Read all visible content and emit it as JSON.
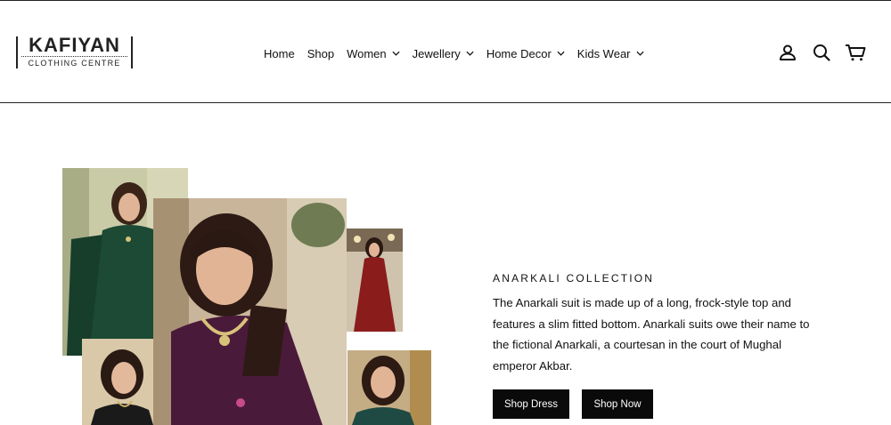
{
  "header": {
    "logo": {
      "name": "KAFIYAN",
      "tagline": "CLOTHING CENTRE"
    },
    "nav": [
      {
        "label": "Home",
        "dropdown": false
      },
      {
        "label": "Shop",
        "dropdown": false
      },
      {
        "label": "Women",
        "dropdown": true
      },
      {
        "label": "Jewellery",
        "dropdown": true
      },
      {
        "label": "Home Decor",
        "dropdown": true
      },
      {
        "label": "Kids Wear",
        "dropdown": true
      }
    ],
    "icons": [
      "account-icon",
      "search-icon",
      "cart-icon"
    ]
  },
  "hero": {
    "collage": [
      {
        "name": "model-green-anarkali-photo",
        "dress_color": "#1c4a34"
      },
      {
        "name": "model-purple-anarkali-photo",
        "dress_color": "#4a1a3a"
      },
      {
        "name": "model-red-gown-photo",
        "dress_color": "#8b1c1c"
      },
      {
        "name": "model-teal-suit-photo",
        "dress_color": "#1f4a44"
      },
      {
        "name": "model-black-suit-photo",
        "dress_color": "#1a1a1a"
      }
    ],
    "eyebrow": "ANARKALI COLLECTION",
    "description": "The Anarkali suit is made up of a long, frock-style top and features a slim fitted bottom. Anarkali suits owe their name to the fictional Anarkali, a courtesan in the court of Mughal emperor Akbar.",
    "buttons": {
      "shop_dress": "Shop Dress",
      "shop_now": "Shop Now"
    }
  },
  "colors": {
    "text": "#111111",
    "button_bg": "#0a0a0a",
    "button_text": "#ffffff",
    "border": "#222222"
  }
}
